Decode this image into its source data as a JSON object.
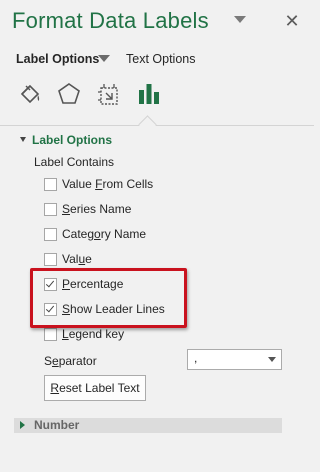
{
  "pane": {
    "title": "Format Data Labels",
    "close_glyph": "✕"
  },
  "tabs": {
    "label_options": "Label Options",
    "text_options": "Text Options"
  },
  "icons": [
    "fill-line-icon",
    "effects-icon",
    "size-properties-icon",
    "label-options-icon"
  ],
  "accent_color": "#217346",
  "section": {
    "header": "Label Options",
    "contains_label": "Label Contains",
    "options": [
      {
        "pre": "Value ",
        "ul": "F",
        "post": "rom Cells",
        "checked": false
      },
      {
        "pre": "",
        "ul": "S",
        "post": "eries Name",
        "checked": false
      },
      {
        "pre": "Categ",
        "ul": "o",
        "post": "ry Name",
        "checked": false
      },
      {
        "pre": "Val",
        "ul": "u",
        "post": "e",
        "checked": false
      },
      {
        "pre": "",
        "ul": "P",
        "post": "ercentage",
        "checked": true
      },
      {
        "pre": "",
        "ul": "S",
        "post": "how Leader Lines",
        "checked": true
      },
      {
        "pre": "",
        "ul": "L",
        "post": "egend key",
        "checked": false
      }
    ],
    "separator_label_pre": "S",
    "separator_label_ul": "e",
    "separator_label_post": "parator",
    "separator_value": ",",
    "reset_pre": "",
    "reset_ul": "R",
    "reset_post": "eset Label Text"
  },
  "number_section": {
    "header": "Number"
  }
}
